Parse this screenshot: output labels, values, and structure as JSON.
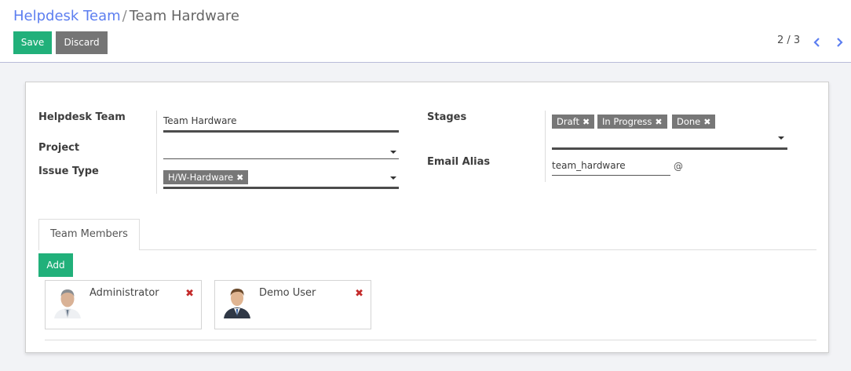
{
  "breadcrumb": {
    "parent": "Helpdesk Team",
    "separator": "/",
    "current": "Team Hardware"
  },
  "toolbar": {
    "save_label": "Save",
    "discard_label": "Discard"
  },
  "pager": {
    "value": "2 / 3"
  },
  "form": {
    "team_label": "Helpdesk Team",
    "team_value": "Team Hardware",
    "project_label": "Project",
    "project_value": "",
    "issue_type_label": "Issue Type",
    "issue_type_tags": [
      "H/W-Hardware"
    ],
    "stages_label": "Stages",
    "stages_tags": [
      "Draft",
      "In Progress",
      "Done"
    ],
    "email_alias_label": "Email Alias",
    "email_alias_value": "team_hardware",
    "email_alias_domain": "@"
  },
  "tabs": [
    {
      "label": "Team Members"
    }
  ],
  "team_members": {
    "add_label": "Add",
    "members": [
      {
        "name": "Administrator"
      },
      {
        "name": "Demo User"
      }
    ]
  },
  "colors": {
    "accent": "#21b07a",
    "link": "#5c7ef0",
    "remove": "#c42b2b",
    "tag": "#777777"
  },
  "icons": {
    "remove": "close-icon",
    "pager_prev": "chevron-left-icon",
    "pager_next": "chevron-right-icon",
    "dropdown": "caret-down-icon"
  }
}
